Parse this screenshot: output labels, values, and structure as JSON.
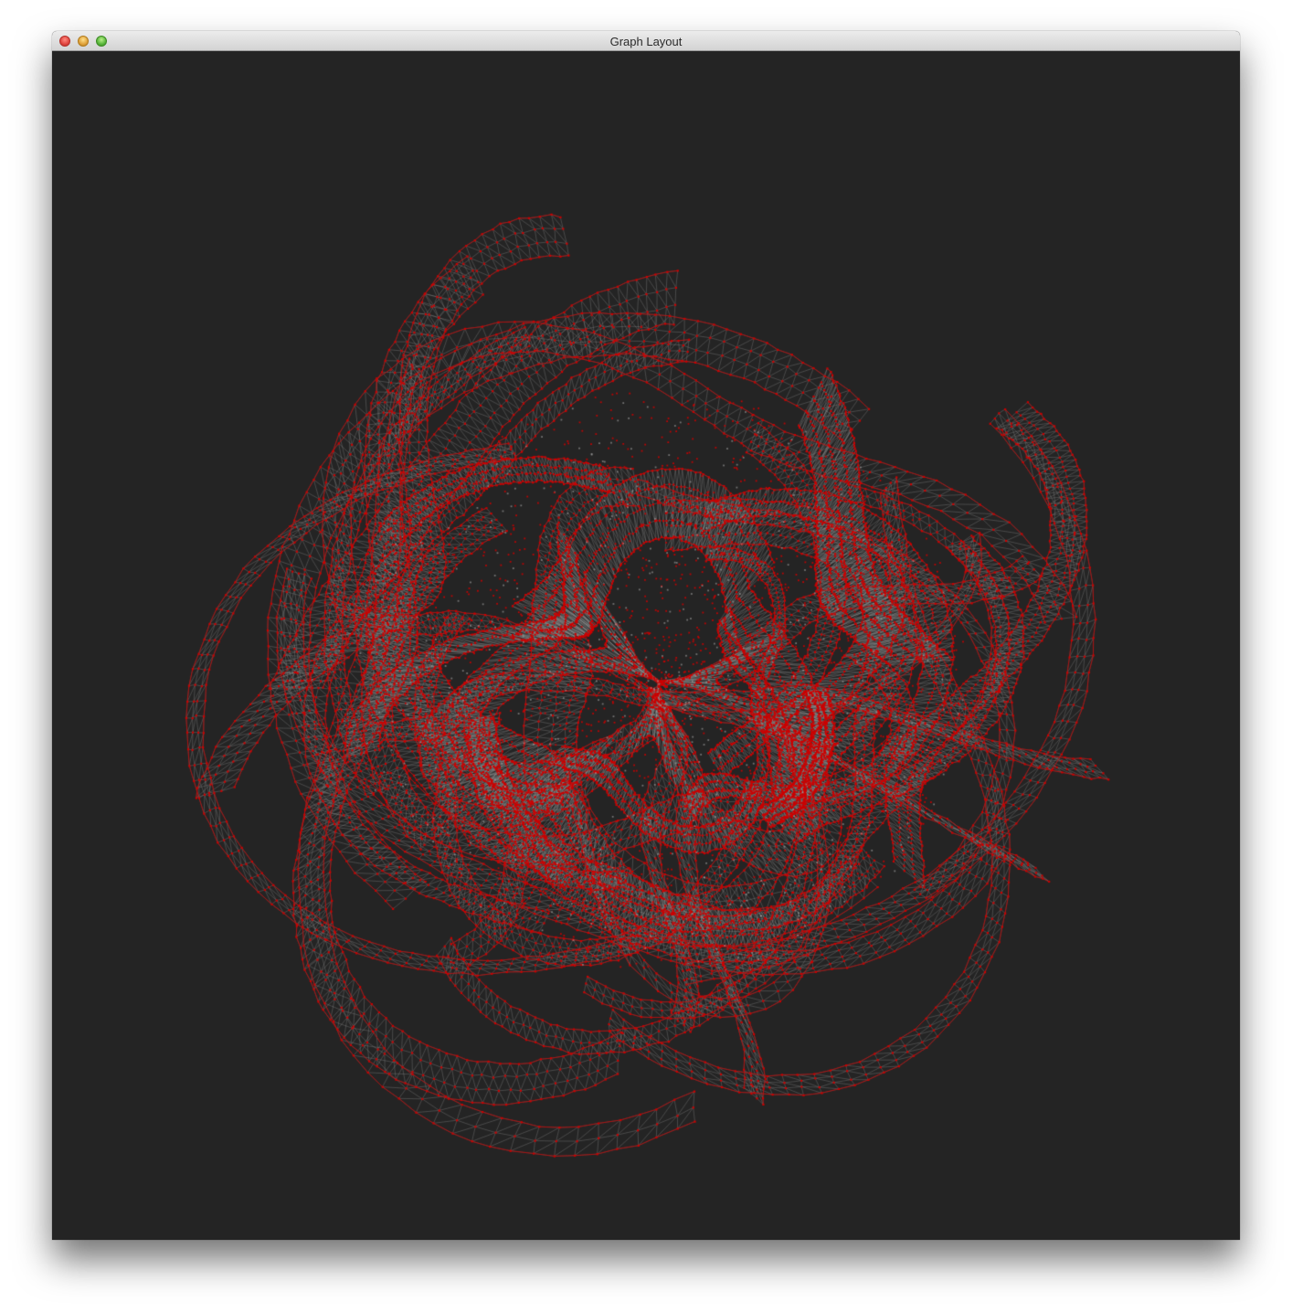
{
  "window": {
    "title": "Graph Layout"
  },
  "colors": {
    "background": "#242424",
    "node": "#cc0000",
    "edge": "#9a9a9a",
    "titlebar_top": "#ececec",
    "titlebar_bottom": "#d3d3d3"
  },
  "icons": {
    "close": "close-icon",
    "minimize": "minimize-icon",
    "maximize": "maximize-icon"
  }
}
